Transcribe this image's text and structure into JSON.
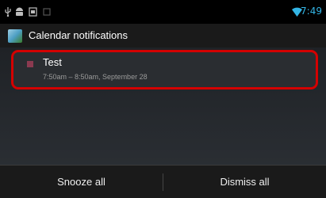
{
  "status_bar": {
    "time": "7:49",
    "icons": [
      "usb-icon",
      "android-debug-icon",
      "screenshot-icon",
      "notification-icon",
      "wifi-icon"
    ],
    "accent_color": "#33b5e5"
  },
  "header": {
    "title": "Calendar notifications",
    "icon": "calendar-app-icon"
  },
  "notification": {
    "title": "Test",
    "time_range": "7:50am – 8:50am, September 28",
    "color": "#8b3a50"
  },
  "actions": {
    "snooze_label": "Snooze all",
    "dismiss_label": "Dismiss all"
  }
}
